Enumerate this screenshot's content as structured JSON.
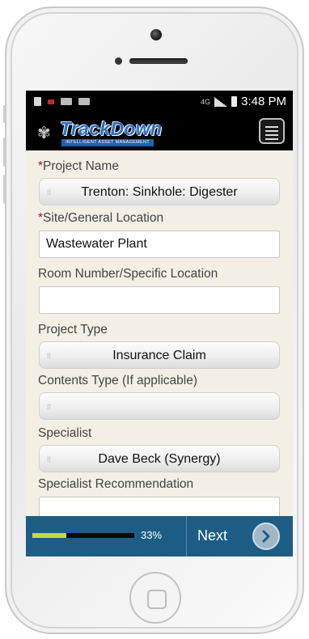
{
  "statusbar": {
    "network": "4G",
    "time": "3:48 PM",
    "icons": [
      "sd-card-icon",
      "alert-icon",
      "sync-icon",
      "mail-icon"
    ]
  },
  "app": {
    "logo_text": "TrackDown",
    "logo_subtitle": "INTELLIGENT ASSET MANAGEMENT"
  },
  "form": {
    "required_mark": "*",
    "project_name": {
      "label": "Project Name",
      "value": "Trenton:  Sinkhole: Digester"
    },
    "site_location": {
      "label": "Site/General Location",
      "value": "Wastewater Plant"
    },
    "room_number": {
      "label": "Room Number/Specific Location",
      "value": ""
    },
    "project_type": {
      "label": "Project Type",
      "value": "Insurance Claim"
    },
    "contents_type": {
      "label": "Contents Type (If applicable)",
      "value": ""
    },
    "specialist": {
      "label": "Specialist",
      "value": "Dave Beck (Synergy)"
    },
    "specialist_recommendation": {
      "label": "Specialist Recommendation",
      "value": ""
    }
  },
  "footer": {
    "progress_percent": 33,
    "progress_label": "33%",
    "next_label": "Next"
  },
  "colors": {
    "footer_bg": "#1d5d85",
    "progress_fill": "#b9e03a",
    "required": "#d0021b",
    "form_bg": "#f3efe4",
    "logo_blue": "#2c6fc0"
  }
}
